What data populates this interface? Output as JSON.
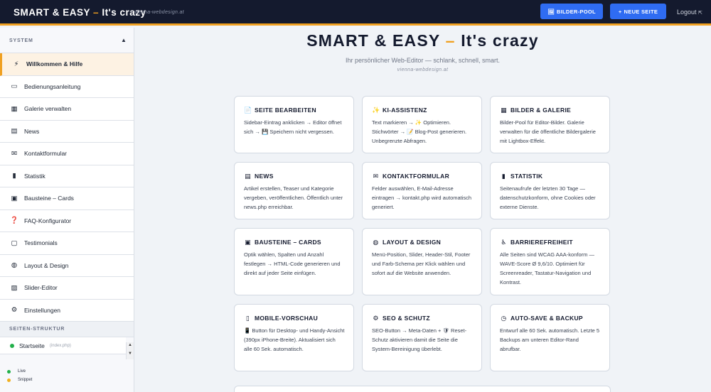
{
  "header": {
    "brand_left": "SMART & EASY",
    "brand_dash": "–",
    "brand_right": "It's crazy",
    "brand_sub": "vienna-webdesign.at",
    "btn_pool": "BILDER-POOL",
    "btn_pool_icon": "🖼",
    "btn_new": "NEUE SEITE",
    "btn_new_icon": "+",
    "logout": "Logout",
    "logout_icon": "⇱",
    "accent": "#f0a020",
    "button_color": "#2f6cf2"
  },
  "sidebar": {
    "system_label": "SYSTEM",
    "items": [
      {
        "icon": "⚡",
        "icon_name": "lightning-icon",
        "label": "Willkommen & Hilfe",
        "active": true
      },
      {
        "icon": "▭",
        "icon_name": "monitor-icon",
        "label": "Bedienungsanleitung"
      },
      {
        "icon": "▦",
        "icon_name": "gallery-icon",
        "label": "Galerie verwalten"
      },
      {
        "icon": "▤",
        "icon_name": "news-icon",
        "label": "News"
      },
      {
        "icon": "✉",
        "icon_name": "envelope-icon",
        "label": "Kontaktformular"
      },
      {
        "icon": "▮",
        "icon_name": "chart-icon",
        "label": "Statistik"
      },
      {
        "icon": "▣",
        "icon_name": "card-icon",
        "label": "Bausteine – Cards"
      },
      {
        "icon": "❓",
        "icon_name": "question-icon",
        "label": "FAQ-Konfigurator"
      },
      {
        "icon": "▢",
        "icon_name": "speech-bubble-icon",
        "label": "Testimonials"
      },
      {
        "icon": "◍",
        "icon_name": "palette-icon",
        "label": "Layout & Design"
      },
      {
        "icon": "▨",
        "icon_name": "slider-icon",
        "label": "Slider-Editor"
      },
      {
        "icon": "⚙",
        "icon_name": "gear-icon",
        "label": "Einstellungen"
      }
    ],
    "structure_label": "SEITEN-STRUKTUR",
    "page": {
      "name": "Startseite",
      "file": "(index.php)"
    },
    "legend": [
      {
        "label": "Live",
        "color": "#22b04a"
      },
      {
        "label": "Snippet",
        "color": "#f0b020"
      }
    ]
  },
  "main": {
    "title_left": "SMART & EASY",
    "title_dash": "–",
    "title_right": "It's crazy",
    "subtitle": "Ihr persönlicher Web-Editor — schlank, schnell, smart.",
    "subtitle2": "vienna-webdesign.at",
    "cards": [
      {
        "icon": "📄",
        "icon_name": "document-icon",
        "title": "SEITE BEARBEITEN",
        "text": "Sidebar-Eintrag anklicken → Editor öffnet sich → 💾 Speichern nicht vergessen."
      },
      {
        "icon": "✨",
        "icon_name": "sparkles-icon",
        "title": "KI-ASSISTENZ",
        "text": "Text markieren → ✨ Optimieren. Stichwörter → 📝 Blog-Post generieren. Unbegrenzte Abfragen."
      },
      {
        "icon": "▦",
        "icon_name": "images-icon",
        "title": "BILDER & GALERIE",
        "text": "Bilder-Pool für Editor-Bilder. Galerie verwalten für die öffentliche Bildergalerie mit Lightbox-Effekt."
      },
      {
        "icon": "▤",
        "icon_name": "news-icon",
        "title": "NEWS",
        "text": "Artikel erstellen, Teaser und Kategorie vergeben, veröffentlichen. Öffentlich unter news.php erreichbar."
      },
      {
        "icon": "✉",
        "icon_name": "envelope-icon",
        "title": "KONTAKTFORMULAR",
        "text": "Felder auswählen, E-Mail-Adresse eintragen → kontakt.php wird automatisch generiert."
      },
      {
        "icon": "▮",
        "icon_name": "chart-icon",
        "title": "STATISTIK",
        "text": "Seitenaufrufe der letzten 30 Tage — datenschutzkonform, ohne Cookies oder externe Dienste."
      },
      {
        "icon": "▣",
        "icon_name": "card-icon",
        "title": "BAUSTEINE – CARDS",
        "text": "Optik wählen, Spalten und Anzahl festlegen → HTML-Code generieren und direkt auf jeder Seite einfügen."
      },
      {
        "icon": "◍",
        "icon_name": "palette-icon",
        "title": "LAYOUT & DESIGN",
        "text": "Menü-Position, Slider, Header-Stil, Footer und Farb-Schema per Klick wählen und sofort auf die Website anwenden."
      },
      {
        "icon": "♿",
        "icon_name": "accessibility-icon",
        "title": "BARRIEREFREIHEIT",
        "text": "Alle Seiten sind WCAG AAA-konform — WAVE-Score Ø 9,6/10. Optimiert für Screenreader, Tastatur-Navigation und Kontrast."
      },
      {
        "icon": "▯",
        "icon_name": "mobile-icon",
        "title": "MOBILE-VORSCHAU",
        "text": "📱 Button für Desktop- und Handy-Ansicht (390px iPhone-Breite). Aktualisiert sich alle 60 Sek. automatisch."
      },
      {
        "icon": "⚙",
        "icon_name": "shield-gear-icon",
        "title": "SEO & SCHUTZ",
        "text": "SEO-Button → Meta-Daten + 🛡 Reset-Schutz aktivieren damit die Seite die System-Bereinigung überlebt."
      },
      {
        "icon": "◷",
        "icon_name": "clock-icon",
        "title": "AUTO-SAVE & BACKUP",
        "text": "Entwurf alle 60 Sek. automatisch. Letzte 5 Backups am unteren Editor-Rand abrufbar."
      }
    ]
  }
}
